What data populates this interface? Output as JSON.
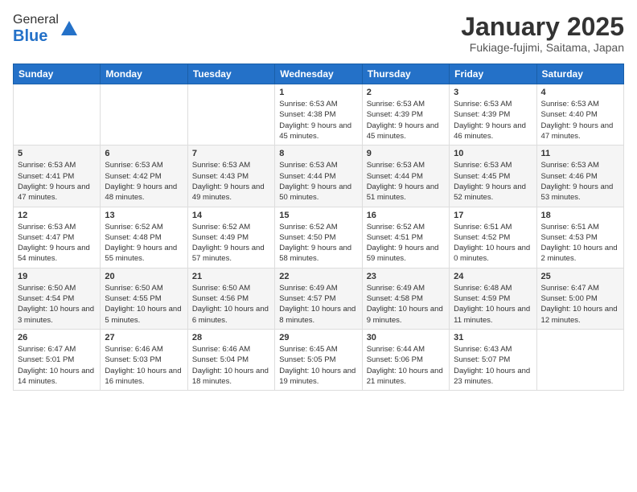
{
  "header": {
    "logo_general": "General",
    "logo_blue": "Blue",
    "month_title": "January 2025",
    "location": "Fukiage-fujimi, Saitama, Japan"
  },
  "weekdays": [
    "Sunday",
    "Monday",
    "Tuesday",
    "Wednesday",
    "Thursday",
    "Friday",
    "Saturday"
  ],
  "weeks": [
    [
      {
        "day": "",
        "info": ""
      },
      {
        "day": "",
        "info": ""
      },
      {
        "day": "",
        "info": ""
      },
      {
        "day": "1",
        "info": "Sunrise: 6:53 AM\nSunset: 4:38 PM\nDaylight: 9 hours and 45 minutes."
      },
      {
        "day": "2",
        "info": "Sunrise: 6:53 AM\nSunset: 4:39 PM\nDaylight: 9 hours and 45 minutes."
      },
      {
        "day": "3",
        "info": "Sunrise: 6:53 AM\nSunset: 4:39 PM\nDaylight: 9 hours and 46 minutes."
      },
      {
        "day": "4",
        "info": "Sunrise: 6:53 AM\nSunset: 4:40 PM\nDaylight: 9 hours and 47 minutes."
      }
    ],
    [
      {
        "day": "5",
        "info": "Sunrise: 6:53 AM\nSunset: 4:41 PM\nDaylight: 9 hours and 47 minutes."
      },
      {
        "day": "6",
        "info": "Sunrise: 6:53 AM\nSunset: 4:42 PM\nDaylight: 9 hours and 48 minutes."
      },
      {
        "day": "7",
        "info": "Sunrise: 6:53 AM\nSunset: 4:43 PM\nDaylight: 9 hours and 49 minutes."
      },
      {
        "day": "8",
        "info": "Sunrise: 6:53 AM\nSunset: 4:44 PM\nDaylight: 9 hours and 50 minutes."
      },
      {
        "day": "9",
        "info": "Sunrise: 6:53 AM\nSunset: 4:44 PM\nDaylight: 9 hours and 51 minutes."
      },
      {
        "day": "10",
        "info": "Sunrise: 6:53 AM\nSunset: 4:45 PM\nDaylight: 9 hours and 52 minutes."
      },
      {
        "day": "11",
        "info": "Sunrise: 6:53 AM\nSunset: 4:46 PM\nDaylight: 9 hours and 53 minutes."
      }
    ],
    [
      {
        "day": "12",
        "info": "Sunrise: 6:53 AM\nSunset: 4:47 PM\nDaylight: 9 hours and 54 minutes."
      },
      {
        "day": "13",
        "info": "Sunrise: 6:52 AM\nSunset: 4:48 PM\nDaylight: 9 hours and 55 minutes."
      },
      {
        "day": "14",
        "info": "Sunrise: 6:52 AM\nSunset: 4:49 PM\nDaylight: 9 hours and 57 minutes."
      },
      {
        "day": "15",
        "info": "Sunrise: 6:52 AM\nSunset: 4:50 PM\nDaylight: 9 hours and 58 minutes."
      },
      {
        "day": "16",
        "info": "Sunrise: 6:52 AM\nSunset: 4:51 PM\nDaylight: 9 hours and 59 minutes."
      },
      {
        "day": "17",
        "info": "Sunrise: 6:51 AM\nSunset: 4:52 PM\nDaylight: 10 hours and 0 minutes."
      },
      {
        "day": "18",
        "info": "Sunrise: 6:51 AM\nSunset: 4:53 PM\nDaylight: 10 hours and 2 minutes."
      }
    ],
    [
      {
        "day": "19",
        "info": "Sunrise: 6:50 AM\nSunset: 4:54 PM\nDaylight: 10 hours and 3 minutes."
      },
      {
        "day": "20",
        "info": "Sunrise: 6:50 AM\nSunset: 4:55 PM\nDaylight: 10 hours and 5 minutes."
      },
      {
        "day": "21",
        "info": "Sunrise: 6:50 AM\nSunset: 4:56 PM\nDaylight: 10 hours and 6 minutes."
      },
      {
        "day": "22",
        "info": "Sunrise: 6:49 AM\nSunset: 4:57 PM\nDaylight: 10 hours and 8 minutes."
      },
      {
        "day": "23",
        "info": "Sunrise: 6:49 AM\nSunset: 4:58 PM\nDaylight: 10 hours and 9 minutes."
      },
      {
        "day": "24",
        "info": "Sunrise: 6:48 AM\nSunset: 4:59 PM\nDaylight: 10 hours and 11 minutes."
      },
      {
        "day": "25",
        "info": "Sunrise: 6:47 AM\nSunset: 5:00 PM\nDaylight: 10 hours and 12 minutes."
      }
    ],
    [
      {
        "day": "26",
        "info": "Sunrise: 6:47 AM\nSunset: 5:01 PM\nDaylight: 10 hours and 14 minutes."
      },
      {
        "day": "27",
        "info": "Sunrise: 6:46 AM\nSunset: 5:03 PM\nDaylight: 10 hours and 16 minutes."
      },
      {
        "day": "28",
        "info": "Sunrise: 6:46 AM\nSunset: 5:04 PM\nDaylight: 10 hours and 18 minutes."
      },
      {
        "day": "29",
        "info": "Sunrise: 6:45 AM\nSunset: 5:05 PM\nDaylight: 10 hours and 19 minutes."
      },
      {
        "day": "30",
        "info": "Sunrise: 6:44 AM\nSunset: 5:06 PM\nDaylight: 10 hours and 21 minutes."
      },
      {
        "day": "31",
        "info": "Sunrise: 6:43 AM\nSunset: 5:07 PM\nDaylight: 10 hours and 23 minutes."
      },
      {
        "day": "",
        "info": ""
      }
    ]
  ]
}
